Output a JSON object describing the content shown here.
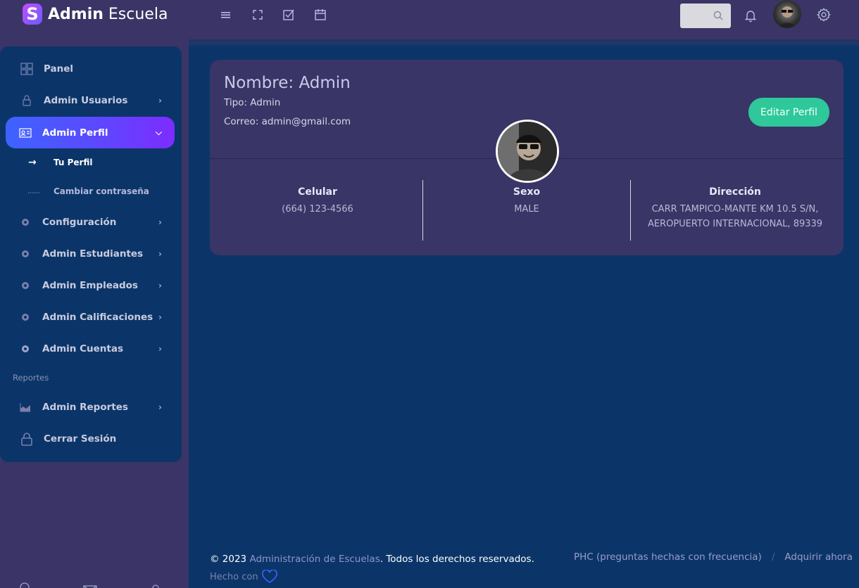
{
  "brand": {
    "bold": "Admin",
    "rest": " Escuela",
    "logo_letter": "S"
  },
  "topbar": {
    "icons": [
      "menu-icon",
      "fullscreen-icon",
      "checkbox-icon",
      "calendar-icon"
    ],
    "search_placeholder": "",
    "right_icons": [
      "bell-icon",
      "avatar",
      "gear-icon"
    ]
  },
  "sidebar": {
    "items": [
      {
        "label": "Panel",
        "icon": "dashboard-icon"
      },
      {
        "label": "Admin Usuarios",
        "icon": "lock-icon"
      },
      {
        "label": "Admin Perfil",
        "icon": "id-card-icon"
      },
      {
        "label": "Configuración",
        "icon": "gear-icon"
      },
      {
        "label": "Admin Estudiantes",
        "icon": "gear-icon"
      },
      {
        "label": "Admin Empleados",
        "icon": "gear-icon"
      },
      {
        "label": "Admin Calificaciones",
        "icon": "gear-icon"
      },
      {
        "label": "Admin Cuentas",
        "icon": "gear-icon"
      },
      {
        "label": "Admin Reportes",
        "icon": "chart-icon"
      },
      {
        "label": "Cerrar Sesión",
        "icon": "lock-icon"
      }
    ],
    "subitems": [
      {
        "label": "Tu Perfil"
      },
      {
        "label": "Cambiar contraseña"
      }
    ],
    "section": "Reportes"
  },
  "profile": {
    "name": "Nombre: Admin",
    "tipo": "Tipo: Admin",
    "correo": "Correo: admin@gmail.com",
    "edit_label": "Editar Perfil",
    "celular_h": "Celular",
    "celular_v": "(664) 123-4566",
    "sexo_h": "Sexo",
    "sexo_v": "MALE",
    "direccion_h": "Dirección",
    "direccion_v1": "CARR TAMPICO-MANTE KM 10.5 S/N,",
    "direccion_v2": "AEROPUERTO INTERNACIONAL, 89339"
  },
  "footer": {
    "copy": "© 2023 ",
    "link": "Administración de Escuelas",
    "rights": ". Todos los derechos reservados.",
    "made": "Hecho con",
    "faq": "PHC (preguntas hechas con frecuencia)",
    "sep": "/",
    "buy": "Adquirir ahora"
  }
}
